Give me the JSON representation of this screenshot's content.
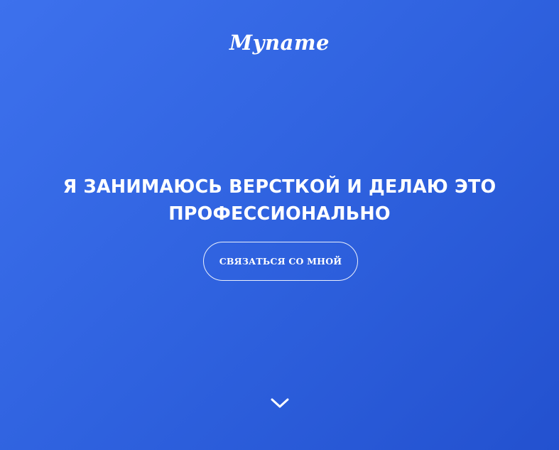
{
  "header": {
    "logo_text": "Myname"
  },
  "hero": {
    "headline_line1": "Я ЗАНИМАЮСЬ ВЕРСТКОЙ И ДЕЛАЮ ЭТО",
    "headline_line2": "ПРОФЕССИОНАЛЬНО",
    "cta_label": "СВЯЗАТЬСЯ СО МНОЙ"
  },
  "icons": {
    "scroll": "chevron-down-icon"
  },
  "colors": {
    "gradient_start": "#3d71ed",
    "gradient_end": "#2351cf",
    "text": "#ffffff"
  }
}
